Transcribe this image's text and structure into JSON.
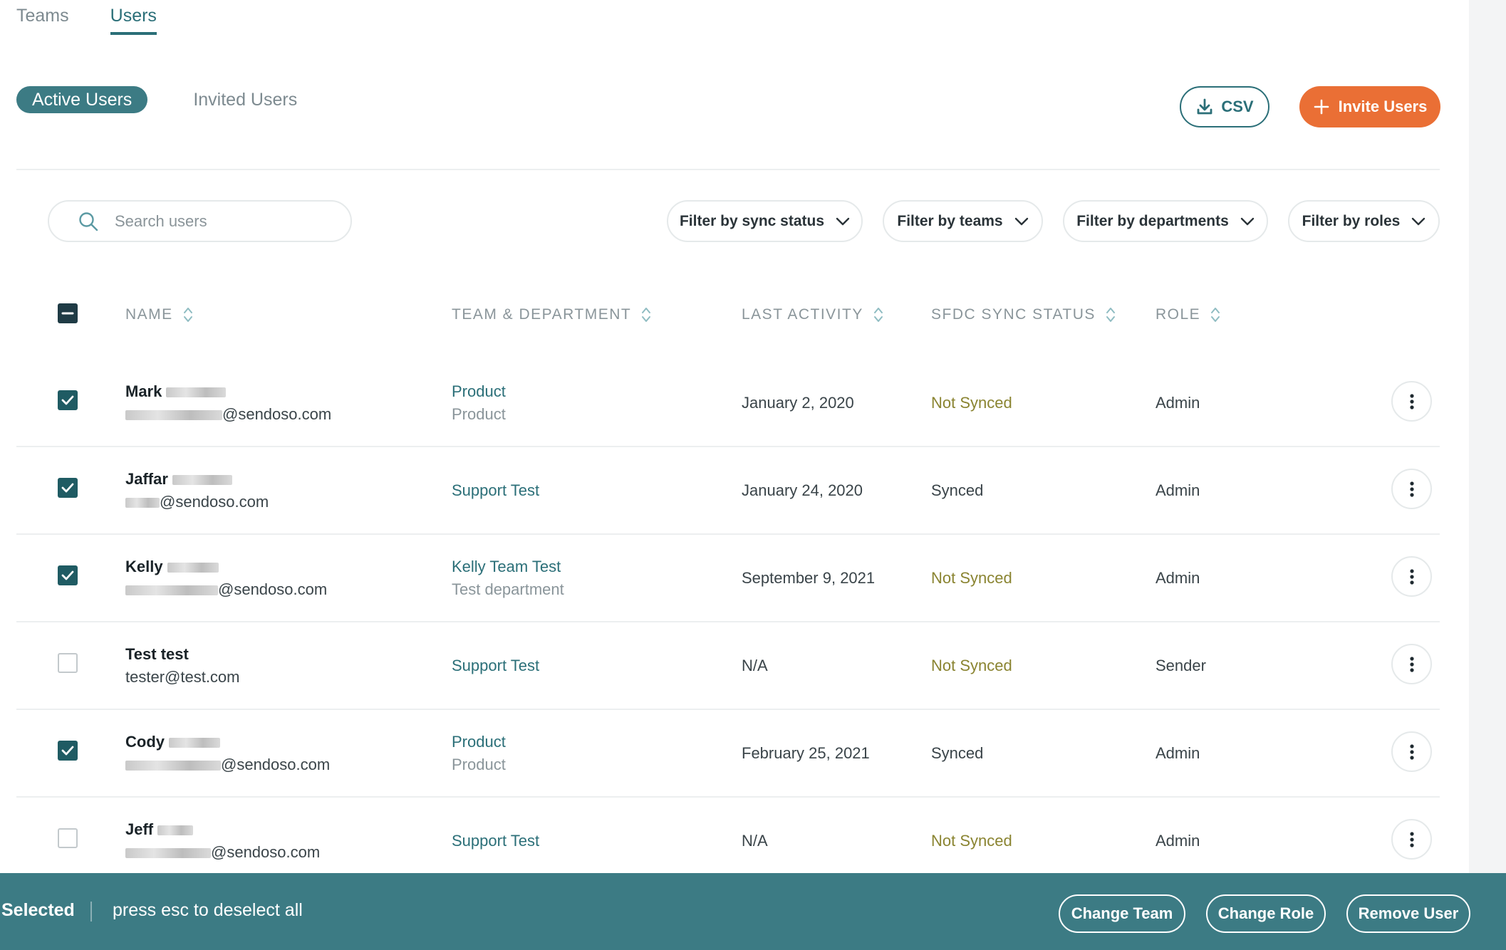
{
  "top_tabs": {
    "teams": "Teams",
    "users": "Users"
  },
  "sub_tabs": {
    "active": "Active Users",
    "invited": "Invited Users"
  },
  "actions": {
    "csv": "CSV",
    "invite": "Invite Users"
  },
  "search": {
    "placeholder": "Search users"
  },
  "filters": {
    "sync": "Filter by sync status",
    "teams": "Filter by teams",
    "departments": "Filter by departments",
    "roles": "Filter by roles"
  },
  "columns": {
    "name": "NAME",
    "team": "TEAM & DEPARTMENT",
    "activity": "LAST ACTIVITY",
    "sync": "SFDC SYNC STATUS",
    "role": "ROLE"
  },
  "rows": [
    {
      "checked": true,
      "first_name": "Mark",
      "email_domain": "@sendoso.com",
      "team": "Product",
      "department": "Product",
      "activity": "January 2, 2020",
      "sync": "Not Synced",
      "role": "Admin"
    },
    {
      "checked": true,
      "first_name": "Jaffar",
      "email_domain": "@sendoso.com",
      "team": "Support Test",
      "department": "",
      "activity": "January 24, 2020",
      "sync": "Synced",
      "role": "Admin"
    },
    {
      "checked": true,
      "first_name": "Kelly",
      "email_domain": "@sendoso.com",
      "team": "Kelly Team Test",
      "department": "Test department",
      "activity": "September 9, 2021",
      "sync": "Not Synced",
      "role": "Admin"
    },
    {
      "checked": false,
      "first_name": "Test test",
      "email_domain": "tester@test.com",
      "team": "Support Test",
      "department": "",
      "activity": "N/A",
      "sync": "Not Synced",
      "role": "Sender"
    },
    {
      "checked": true,
      "first_name": "Cody",
      "email_domain": "@sendoso.com",
      "team": "Product",
      "department": "Product",
      "activity": "February 25, 2021",
      "sync": "Synced",
      "role": "Admin"
    },
    {
      "checked": false,
      "first_name": "Jeff",
      "email_domain": "@sendoso.com",
      "team": "Support Test",
      "department": "",
      "activity": "N/A",
      "sync": "Not Synced",
      "role": "Admin"
    }
  ],
  "bottom_bar": {
    "selected": "Selected",
    "hint": "press esc to deselect all",
    "change_team": "Change Team",
    "change_role": "Change Role",
    "remove_user": "Remove User"
  },
  "colors": {
    "primary": "#2b6f78",
    "bar": "#3c7b84",
    "accent": "#ea6f35",
    "not_synced": "#8a8431"
  },
  "icons": [
    "search-icon",
    "download-icon",
    "plus-icon",
    "chevron-down-icon",
    "sort-icon",
    "more-vertical-icon",
    "checkbox-icon"
  ]
}
